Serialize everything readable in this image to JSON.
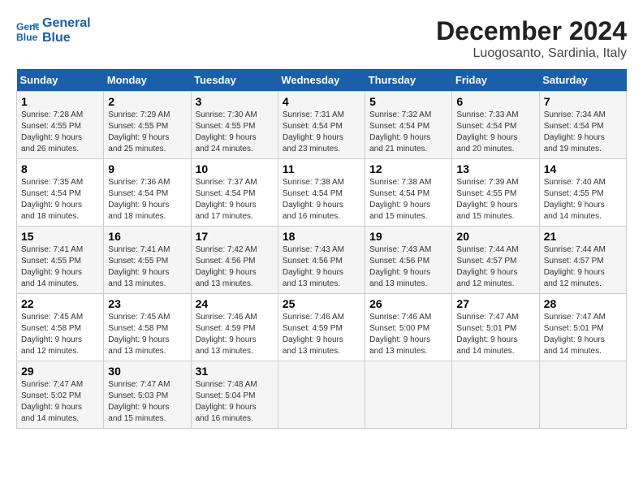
{
  "logo": {
    "line1": "General",
    "line2": "Blue"
  },
  "title": "December 2024",
  "subtitle": "Luogosanto, Sardinia, Italy",
  "days_header": [
    "Sunday",
    "Monday",
    "Tuesday",
    "Wednesday",
    "Thursday",
    "Friday",
    "Saturday"
  ],
  "weeks": [
    [
      {
        "day": "1",
        "info": "Sunrise: 7:28 AM\nSunset: 4:55 PM\nDaylight: 9 hours\nand 26 minutes."
      },
      {
        "day": "2",
        "info": "Sunrise: 7:29 AM\nSunset: 4:55 PM\nDaylight: 9 hours\nand 25 minutes."
      },
      {
        "day": "3",
        "info": "Sunrise: 7:30 AM\nSunset: 4:55 PM\nDaylight: 9 hours\nand 24 minutes."
      },
      {
        "day": "4",
        "info": "Sunrise: 7:31 AM\nSunset: 4:54 PM\nDaylight: 9 hours\nand 23 minutes."
      },
      {
        "day": "5",
        "info": "Sunrise: 7:32 AM\nSunset: 4:54 PM\nDaylight: 9 hours\nand 21 minutes."
      },
      {
        "day": "6",
        "info": "Sunrise: 7:33 AM\nSunset: 4:54 PM\nDaylight: 9 hours\nand 20 minutes."
      },
      {
        "day": "7",
        "info": "Sunrise: 7:34 AM\nSunset: 4:54 PM\nDaylight: 9 hours\nand 19 minutes."
      }
    ],
    [
      {
        "day": "8",
        "info": "Sunrise: 7:35 AM\nSunset: 4:54 PM\nDaylight: 9 hours\nand 18 minutes."
      },
      {
        "day": "9",
        "info": "Sunrise: 7:36 AM\nSunset: 4:54 PM\nDaylight: 9 hours\nand 18 minutes."
      },
      {
        "day": "10",
        "info": "Sunrise: 7:37 AM\nSunset: 4:54 PM\nDaylight: 9 hours\nand 17 minutes."
      },
      {
        "day": "11",
        "info": "Sunrise: 7:38 AM\nSunset: 4:54 PM\nDaylight: 9 hours\nand 16 minutes."
      },
      {
        "day": "12",
        "info": "Sunrise: 7:38 AM\nSunset: 4:54 PM\nDaylight: 9 hours\nand 15 minutes."
      },
      {
        "day": "13",
        "info": "Sunrise: 7:39 AM\nSunset: 4:55 PM\nDaylight: 9 hours\nand 15 minutes."
      },
      {
        "day": "14",
        "info": "Sunrise: 7:40 AM\nSunset: 4:55 PM\nDaylight: 9 hours\nand 14 minutes."
      }
    ],
    [
      {
        "day": "15",
        "info": "Sunrise: 7:41 AM\nSunset: 4:55 PM\nDaylight: 9 hours\nand 14 minutes."
      },
      {
        "day": "16",
        "info": "Sunrise: 7:41 AM\nSunset: 4:55 PM\nDaylight: 9 hours\nand 13 minutes."
      },
      {
        "day": "17",
        "info": "Sunrise: 7:42 AM\nSunset: 4:56 PM\nDaylight: 9 hours\nand 13 minutes."
      },
      {
        "day": "18",
        "info": "Sunrise: 7:43 AM\nSunset: 4:56 PM\nDaylight: 9 hours\nand 13 minutes."
      },
      {
        "day": "19",
        "info": "Sunrise: 7:43 AM\nSunset: 4:56 PM\nDaylight: 9 hours\nand 13 minutes."
      },
      {
        "day": "20",
        "info": "Sunrise: 7:44 AM\nSunset: 4:57 PM\nDaylight: 9 hours\nand 12 minutes."
      },
      {
        "day": "21",
        "info": "Sunrise: 7:44 AM\nSunset: 4:57 PM\nDaylight: 9 hours\nand 12 minutes."
      }
    ],
    [
      {
        "day": "22",
        "info": "Sunrise: 7:45 AM\nSunset: 4:58 PM\nDaylight: 9 hours\nand 12 minutes."
      },
      {
        "day": "23",
        "info": "Sunrise: 7:45 AM\nSunset: 4:58 PM\nDaylight: 9 hours\nand 13 minutes."
      },
      {
        "day": "24",
        "info": "Sunrise: 7:46 AM\nSunset: 4:59 PM\nDaylight: 9 hours\nand 13 minutes."
      },
      {
        "day": "25",
        "info": "Sunrise: 7:46 AM\nSunset: 4:59 PM\nDaylight: 9 hours\nand 13 minutes."
      },
      {
        "day": "26",
        "info": "Sunrise: 7:46 AM\nSunset: 5:00 PM\nDaylight: 9 hours\nand 13 minutes."
      },
      {
        "day": "27",
        "info": "Sunrise: 7:47 AM\nSunset: 5:01 PM\nDaylight: 9 hours\nand 14 minutes."
      },
      {
        "day": "28",
        "info": "Sunrise: 7:47 AM\nSunset: 5:01 PM\nDaylight: 9 hours\nand 14 minutes."
      }
    ],
    [
      {
        "day": "29",
        "info": "Sunrise: 7:47 AM\nSunset: 5:02 PM\nDaylight: 9 hours\nand 14 minutes."
      },
      {
        "day": "30",
        "info": "Sunrise: 7:47 AM\nSunset: 5:03 PM\nDaylight: 9 hours\nand 15 minutes."
      },
      {
        "day": "31",
        "info": "Sunrise: 7:48 AM\nSunset: 5:04 PM\nDaylight: 9 hours\nand 16 minutes."
      },
      null,
      null,
      null,
      null
    ]
  ]
}
